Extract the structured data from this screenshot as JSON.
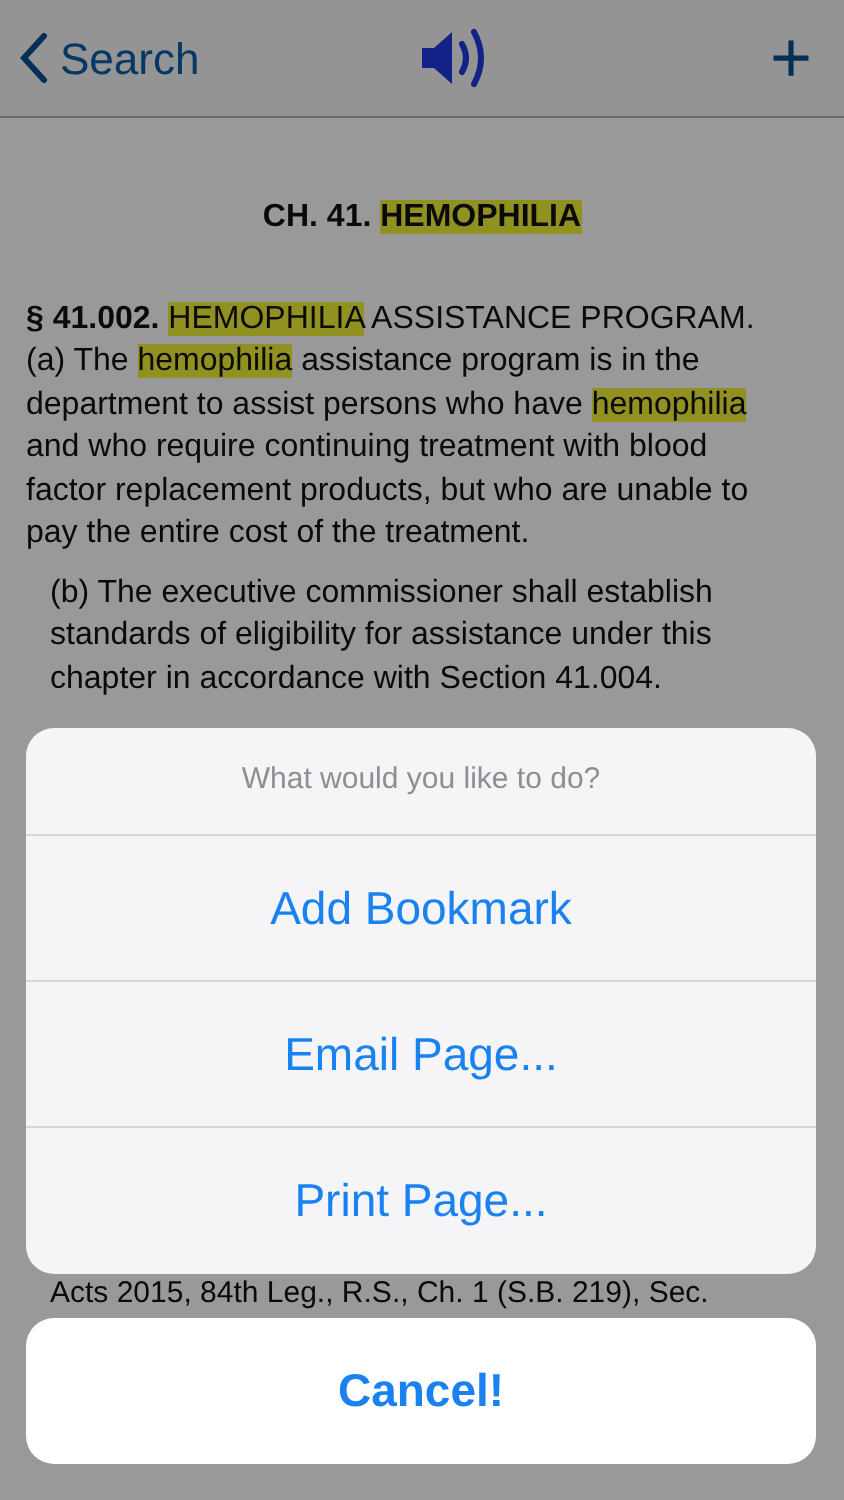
{
  "nav": {
    "back_label": "Search",
    "add_label": "+"
  },
  "document": {
    "heading": [
      {
        "text": "CH. 41. ",
        "kind": "bold"
      },
      {
        "text": "HEMOPHILIA",
        "kind": "bold-highlight"
      }
    ],
    "paragraphs": [
      {
        "kind": "section",
        "segments": [
          {
            "text": "§ 41.002. ",
            "kind": "bold"
          },
          {
            "text": "HEMOPHILIA",
            "kind": "highlight"
          },
          {
            "text": " ASSISTANCE PROGRAM. (a) The ",
            "kind": "plain"
          },
          {
            "text": "hemophilia",
            "kind": "highlight"
          },
          {
            "text": " assistance program is in the department to assist persons who have ",
            "kind": "plain"
          },
          {
            "text": "hemophilia",
            "kind": "highlight"
          },
          {
            "text": " and who require continuing treatment with blood factor replacement products, but who are unable to pay the entire cost of the treatment.",
            "kind": "plain"
          }
        ]
      },
      {
        "kind": "subsection",
        "segments": [
          {
            "text": "(b) The executive commissioner shall establish standards of eligibility for assistance under this chapter in accordance with Section 41.004.",
            "kind": "plain"
          }
        ]
      }
    ],
    "footer_line": "Acts 2015, 84th Leg., R.S., Ch. 1 (S.B. 219), Sec."
  },
  "action_sheet": {
    "title": "What would you like to do?",
    "actions": [
      "Add Bookmark",
      "Email Page...",
      "Print Page..."
    ],
    "cancel": "Cancel!"
  }
}
